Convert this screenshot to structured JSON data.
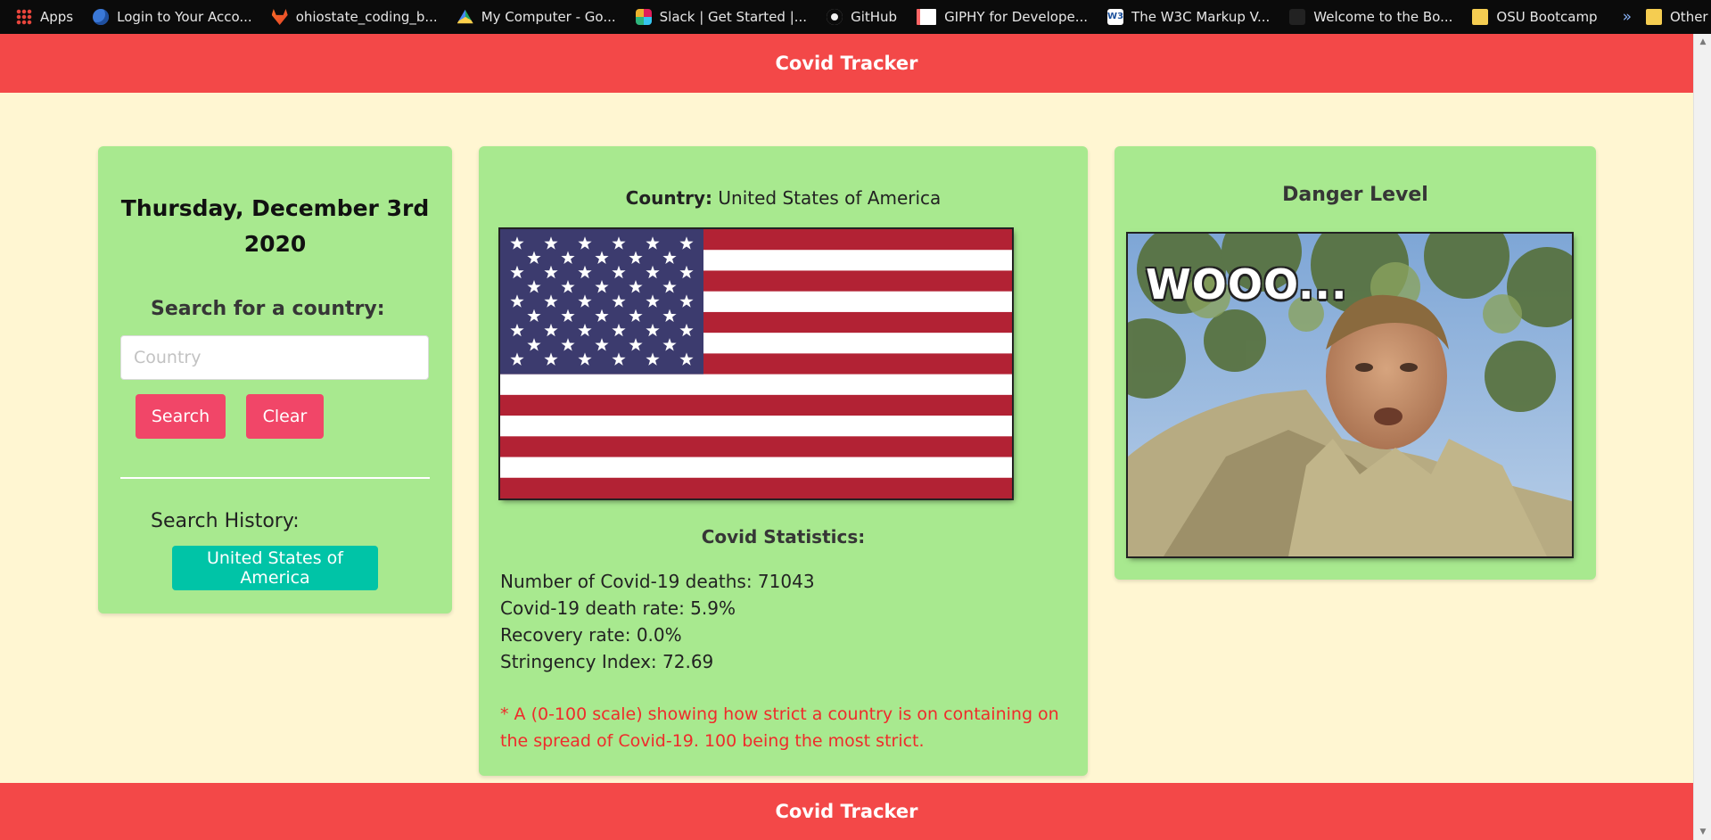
{
  "bookmarks": [
    {
      "label": "Apps",
      "icon": "apps-grid-icon"
    },
    {
      "label": "Login to Your Acco...",
      "icon": "globe-icon"
    },
    {
      "label": "ohiostate_coding_b...",
      "icon": "gitlab-icon"
    },
    {
      "label": "My Computer - Go...",
      "icon": "google-drive-icon"
    },
    {
      "label": "Slack | Get Started |...",
      "icon": "slack-icon"
    },
    {
      "label": "GitHub",
      "icon": "github-icon"
    },
    {
      "label": "GIPHY for Develope...",
      "icon": "giphy-icon"
    },
    {
      "label": "The W3C Markup V...",
      "icon": "w3c-icon"
    },
    {
      "label": "Welcome to the Bo...",
      "icon": "page-icon"
    },
    {
      "label": "OSU Bootcamp",
      "icon": "folder-icon"
    }
  ],
  "bookmarks_overflow": "»",
  "other_bookmarks": {
    "label": "Other bookmarks",
    "icon": "folder-icon"
  },
  "header": {
    "title": "Covid Tracker"
  },
  "footer": {
    "title": "Covid Tracker"
  },
  "sidebar": {
    "date": "Thursday, December 3rd 2020",
    "search_label": "Search for a country:",
    "input_placeholder": "Country",
    "input_value": "",
    "search_button": "Search",
    "clear_button": "Clear",
    "history_label": "Search History:",
    "history": [
      "United States of America"
    ]
  },
  "country": {
    "label": "Country:",
    "name": "United States of America",
    "flag": "us-flag"
  },
  "stats": {
    "title": "Covid Statistics:",
    "deaths": "Number of Covid-19 deaths: 71043",
    "death_rate": "Covid-19 death rate: 5.9%",
    "recovery_rate": "Recovery rate: 0.0%",
    "stringency": "Stringency Index: 72.69",
    "note": "* A (0-100 scale) showing how strict a country is on containing on the spread of Covid-19. 100 being the most strict."
  },
  "danger": {
    "title": "Danger Level",
    "gif_caption": "WOOO..."
  },
  "colors": {
    "header": "#f34848",
    "background": "#fff6d2",
    "card": "#a8e98f",
    "danger_button": "#f14668",
    "history_button": "#00c4a7",
    "note_text": "#ef2b2b"
  }
}
